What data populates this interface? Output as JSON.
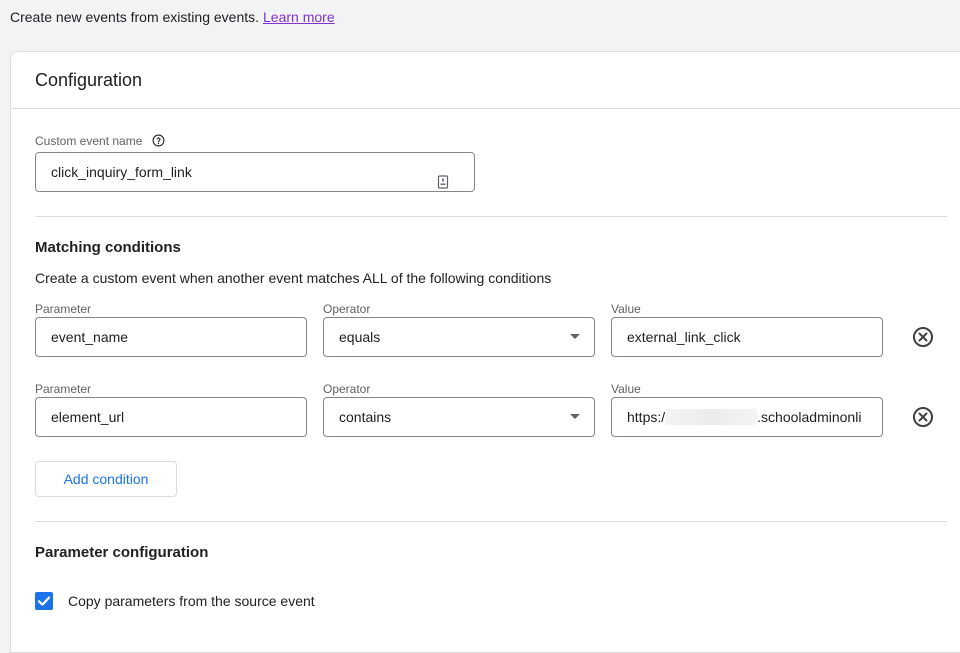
{
  "intro": {
    "text": "Create new events from existing events.",
    "link": "Learn more"
  },
  "card": {
    "title": "Configuration",
    "custom_event_name": {
      "label": "Custom event name",
      "help_icon": "help-circle-icon",
      "value": "click_inquiry_form_link",
      "field_icon": "text-variable-icon"
    },
    "matching": {
      "title": "Matching conditions",
      "description": "Create a custom event when another event matches ALL of the following conditions",
      "column_labels": {
        "parameter": "Parameter",
        "operator": "Operator",
        "value": "Value"
      },
      "conditions": [
        {
          "parameter": "event_name",
          "operator": "equals",
          "value": "external_link_click"
        },
        {
          "parameter": "element_url",
          "operator": "contains",
          "value_prefix": "https:/",
          "value_suffix": ".schooladminonli"
        }
      ],
      "add_condition": "Add condition"
    },
    "parameter_config": {
      "title": "Parameter configuration",
      "copy_params_label": "Copy parameters from the source event",
      "copy_params_checked": true
    }
  },
  "colors": {
    "accent": "#1a73e8",
    "link": "#8430ce",
    "border": "#dadce0",
    "page_bg": "#f1f3f4"
  }
}
